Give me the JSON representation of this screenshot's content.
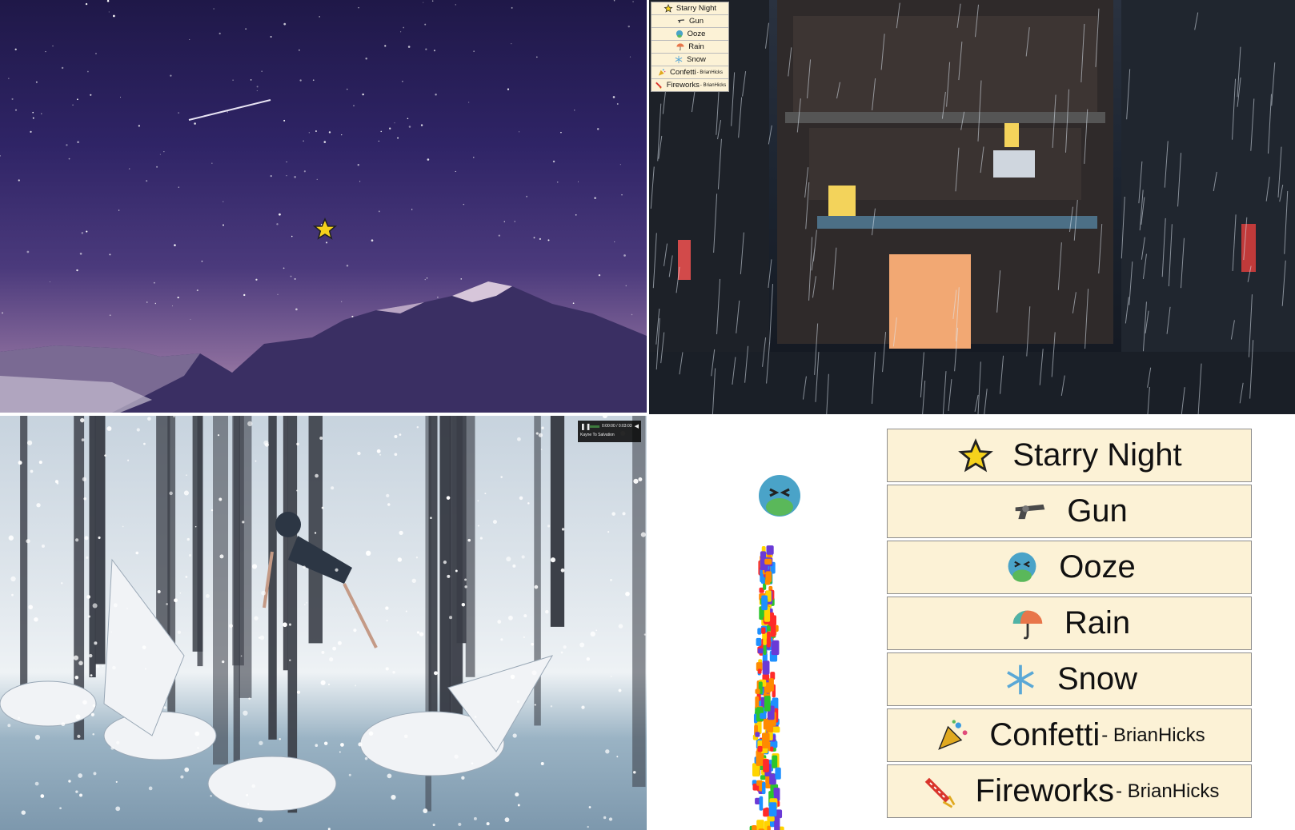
{
  "mini_menu": {
    "items": [
      {
        "label": "Starry Night",
        "byline": "",
        "icon": "star-icon"
      },
      {
        "label": "Gun",
        "byline": "",
        "icon": "gun-icon"
      },
      {
        "label": "Ooze",
        "byline": "",
        "icon": "nauseated-face-icon"
      },
      {
        "label": "Rain",
        "byline": "",
        "icon": "umbrella-icon"
      },
      {
        "label": "Snow",
        "byline": "",
        "icon": "snowflake-icon"
      },
      {
        "label": "Confetti",
        "byline": "- BrianHicks",
        "icon": "party-popper-icon"
      },
      {
        "label": "Fireworks",
        "byline": "- BrianHicks",
        "icon": "firework-rocket-icon"
      }
    ]
  },
  "big_menu": {
    "items": [
      {
        "label": "Starry Night",
        "byline": "",
        "icon": "star-icon"
      },
      {
        "label": "Gun",
        "byline": "",
        "icon": "gun-icon"
      },
      {
        "label": "Ooze",
        "byline": "",
        "icon": "nauseated-face-icon"
      },
      {
        "label": "Rain",
        "byline": "",
        "icon": "umbrella-icon"
      },
      {
        "label": "Snow",
        "byline": "",
        "icon": "snowflake-icon"
      },
      {
        "label": "Confetti",
        "byline": "- BrianHicks",
        "icon": "party-popper-icon"
      },
      {
        "label": "Fireworks",
        "byline": "- BrianHicks",
        "icon": "firework-rocket-icon"
      }
    ]
  },
  "player": {
    "time": "0:00:00 / 0:03:03",
    "track": "Kayne To Salvation"
  },
  "colors": {
    "menu_bg": "#fcf2d6",
    "star": "#f5d21c",
    "ooze_green": "#5ab85a",
    "ooze_face": "#4aa3c8"
  }
}
